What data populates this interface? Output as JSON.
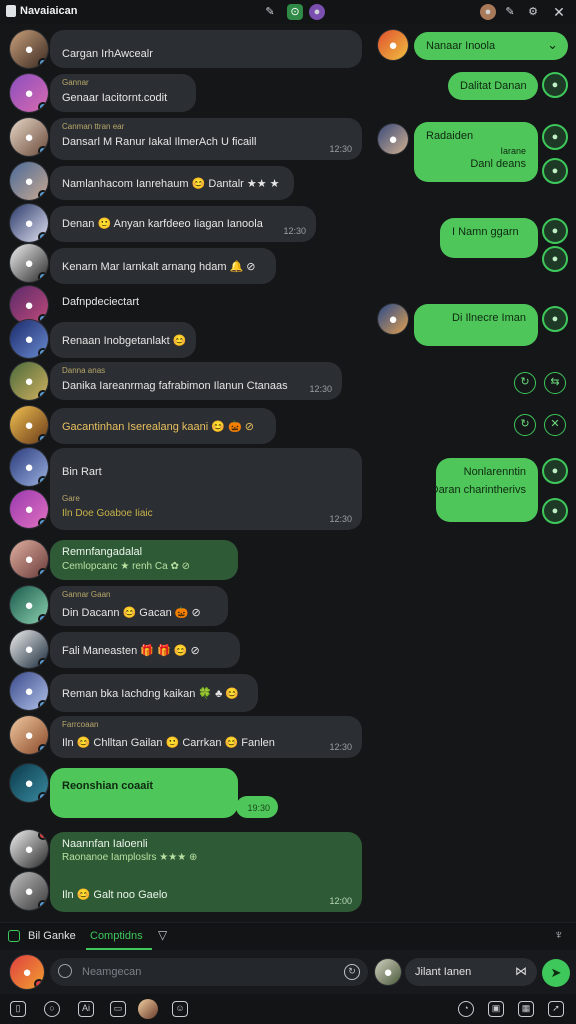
{
  "header": {
    "title": "Navaiaican",
    "icons": [
      "pin-icon",
      "chat-icon",
      "avatar-icon",
      "user-avatar-icon",
      "pen-icon",
      "settings-icon",
      "close-icon"
    ]
  },
  "colors": {
    "background": "#141618",
    "bubble_dark": "#2b2e32",
    "bubble_green": "#4fc65a",
    "bubble_greendark": "#2f5a36",
    "accent": "#3ec75a"
  },
  "left_messages": [
    {
      "top": "Cargan IrhAwcealr",
      "bottom": ""
    },
    {
      "top": "Gannar",
      "bottom": "Genaar Iacitornt.codit"
    },
    {
      "top": "Dansarl M Ranur Iakal IlmerAch U ficaill",
      "sub": "Canman ttran ear",
      "time": "12:30"
    },
    {
      "text": "Namlanhacom Ianrehaum 😊 Dantalr ★★ ★"
    },
    {
      "text": "Denan 🙂 Anyan karfdeeo Iiagan Ianoola",
      "time": "12:30"
    },
    {
      "text": "Kenarn Mar Iarnkalt arnang hdam 🔔 ⊘"
    },
    {
      "text": "Dafnpdeciectart"
    },
    {
      "text": "Renaan Inobgetanlakt 😊"
    },
    {
      "sub": "Danna anas",
      "text": "Danika Iareanrmag fafrabimon Ilanun Ctanaas",
      "time": "12:30"
    },
    {
      "text": "Gacantinhan Iserealang kaani 😊 🎃 ⊘"
    },
    {
      "text": "Bin Rart",
      "sub": "Gare",
      "extra": "Iln Doe Goaboe Iiaic",
      "time": "12:30"
    },
    {
      "text": "Remnfangadalal",
      "sub": "Cemlopcanc ★ renh Ca ✿ ⊘"
    },
    {
      "sub": "Gannar Gaan",
      "text": "Din Dacann 😊 Gacan 🎃 ⊘"
    },
    {
      "text": "Fali Maneasten 🎁 🎁 😊 ⊘"
    },
    {
      "text": "Reman bka Iachdng kaikan 🍀 ♣ 😊"
    },
    {
      "sub": "Farrcoaan",
      "text": "Iln 😊 Chlltan Gailan 🙂 Carrkan 😊 Fanlen",
      "time": "12:30"
    },
    {
      "text": "Reonshian coaait",
      "time": "19:30"
    },
    {
      "text": "Naannfan Ialoenli",
      "sub": "Raonanoe Iamploslrs ★★★ ⊕",
      "extra": "Iln 😊 Galt noo Gaelo",
      "time": "12:00"
    }
  ],
  "right_messages": [
    {
      "text": "Nanaar Inoola"
    },
    {
      "text": "Dalitat Danan"
    },
    {
      "text": "Radaiden",
      "extra": "Iarane",
      "extra2": "Danl deans"
    },
    {
      "text": "I Namn ggarn"
    },
    {
      "text": "Di Ilnecre Iman"
    },
    {
      "text": "Nonlarenntin",
      "extra": "Daran charintherivs"
    }
  ],
  "tabs": {
    "first": "Bil Ganke",
    "second": "Comptidns"
  },
  "input": {
    "placeholder": "Neamgecan",
    "right_value": "Jilant Ianen"
  },
  "bottom_icons": [
    "bookmark-icon",
    "camera-icon",
    "ai-icon",
    "image-icon",
    "avatar-icon",
    "sticker-icon",
    "clock-icon",
    "gallery-icon",
    "gallery2-icon",
    "send-file-icon"
  ]
}
